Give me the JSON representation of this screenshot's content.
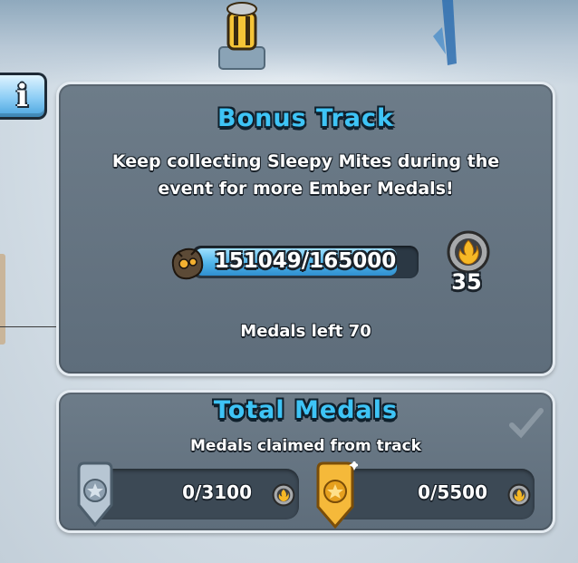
{
  "info_button": {
    "label": "i",
    "icon": "info-icon"
  },
  "bonus_track": {
    "title": "Bonus Track",
    "description_line1": "Keep collecting Sleepy Mites during the",
    "description_line2": "event for more Ember Medals!",
    "progress": {
      "current": 151049,
      "goal": 165000,
      "label": "151049/165000",
      "fraction": 0.915
    },
    "reward": {
      "icon": "ember-medal-icon",
      "amount": "35"
    },
    "medals_left": "Medals left 70"
  },
  "total_medals": {
    "title": "Total Medals",
    "subtitle": "Medals claimed from track",
    "tiers": [
      {
        "name": "silver",
        "badge_icon": "silver-star-badge-icon",
        "value": "0/3100",
        "coin_icon": "ember-medal-icon"
      },
      {
        "name": "gold",
        "badge_icon": "gold-star-badge-icon",
        "value": "0/5500",
        "coin_icon": "ember-medal-icon"
      }
    ],
    "status_icon": "checkmark-icon"
  },
  "colors": {
    "title": "#3ec4f6",
    "panel": "#66757f",
    "progress": "#4fb3e9",
    "gold": "#f5b93a",
    "silver": "#9aaab8"
  }
}
